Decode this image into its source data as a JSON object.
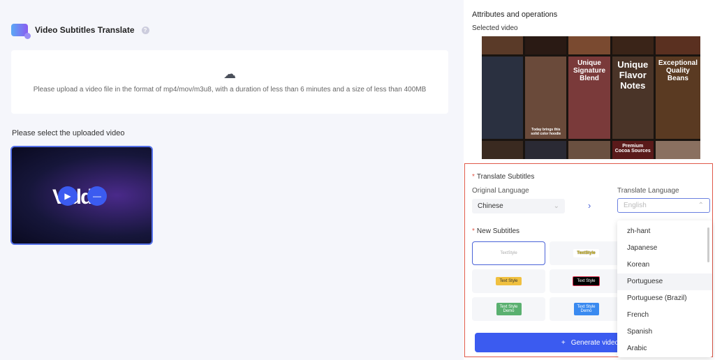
{
  "header": {
    "title": "Video Subtitles Translate",
    "help_icon": "question-icon"
  },
  "upload": {
    "icon": "cloud-upload-icon",
    "hint": "Please upload a video file in the format of mp4/mov/m3u8, with a duration of less than 6 minutes and a size of less than 400MB"
  },
  "video_list": {
    "label": "Please select the uploaded video",
    "thumb_text": "Viddu"
  },
  "panel": {
    "title": "Attributes and operations",
    "selected_label": "Selected video",
    "collage_texts": [
      "Unique Signature Blend",
      "Unique Flavor Notes",
      "Exceptional Quality Beans",
      "Premium Cocoa Sources",
      "Today brings this solid color hoodie"
    ],
    "translate_label": "Translate Subtitles",
    "original_label": "Original Language",
    "original_value": "Chinese",
    "target_label": "Translate Language",
    "target_placeholder": "English",
    "new_subtitles_label": "New Subtitles",
    "styles": [
      "TextStyle",
      "TextStyle",
      "Text Style",
      "Text Style",
      "Text Style Demo",
      "Text Style Demo"
    ],
    "generate_label": "Generate video"
  },
  "dropdown": {
    "options": [
      "zh-hant",
      "Japanese",
      "Korean",
      "Portuguese",
      "Portuguese (Brazil)",
      "French",
      "Spanish",
      "Arabic"
    ],
    "hovered": "Portuguese"
  },
  "colors": {
    "accent": "#3b5bf0",
    "highlight_border": "#e0594a"
  }
}
